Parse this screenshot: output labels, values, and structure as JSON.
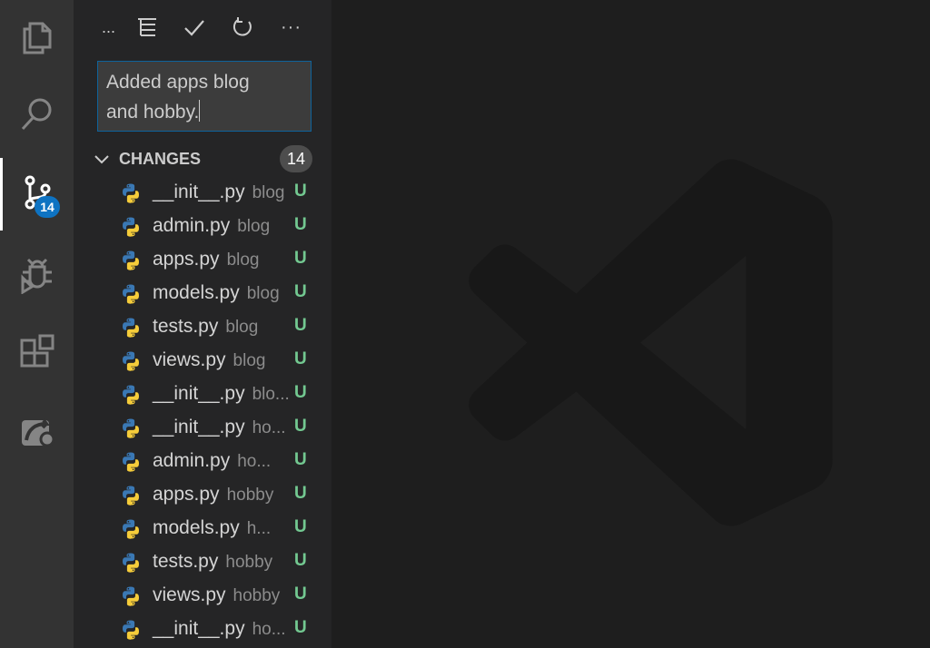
{
  "activity_bar": {
    "items": [
      {
        "name": "explorer",
        "icon": "files-icon"
      },
      {
        "name": "search",
        "icon": "search-icon"
      },
      {
        "name": "source-control",
        "icon": "source-control-icon",
        "badge": "14",
        "active": true
      },
      {
        "name": "run-debug",
        "icon": "debug-icon"
      },
      {
        "name": "extensions",
        "icon": "extensions-icon"
      },
      {
        "name": "remote",
        "icon": "remote-explorer-icon"
      }
    ]
  },
  "toolbar": {
    "items": [
      {
        "name": "more-left",
        "glyph": "..."
      },
      {
        "name": "view-tree",
        "icon": "tree-view-icon"
      },
      {
        "name": "commit",
        "icon": "check-icon"
      },
      {
        "name": "refresh",
        "icon": "refresh-icon"
      },
      {
        "name": "more-actions",
        "glyph": "···"
      }
    ]
  },
  "commit_message": {
    "value": "Added apps blog\nand hobby."
  },
  "changes": {
    "label": "CHANGES",
    "count": "14",
    "files": [
      {
        "name": "__init__.py",
        "dir": "blog",
        "status": "U"
      },
      {
        "name": "admin.py",
        "dir": "blog",
        "status": "U"
      },
      {
        "name": "apps.py",
        "dir": "blog",
        "status": "U"
      },
      {
        "name": "models.py",
        "dir": "blog",
        "status": "U"
      },
      {
        "name": "tests.py",
        "dir": "blog",
        "status": "U"
      },
      {
        "name": "views.py",
        "dir": "blog",
        "status": "U"
      },
      {
        "name": "__init__.py",
        "dir": "blo...",
        "status": "U"
      },
      {
        "name": "__init__.py",
        "dir": "ho...",
        "status": "U"
      },
      {
        "name": "admin.py",
        "dir": "ho...",
        "status": "U"
      },
      {
        "name": "apps.py",
        "dir": "hobby",
        "status": "U"
      },
      {
        "name": "models.py",
        "dir": "h...",
        "status": "U"
      },
      {
        "name": "tests.py",
        "dir": "hobby",
        "status": "U"
      },
      {
        "name": "views.py",
        "dir": "hobby",
        "status": "U"
      },
      {
        "name": "__init__.py",
        "dir": "ho...",
        "status": "U"
      }
    ]
  },
  "colors": {
    "activity_bar": "#333333",
    "sidebar": "#252526",
    "editor": "#1e1e1e",
    "accent": "#0e73c2",
    "untracked": "#73c991"
  }
}
